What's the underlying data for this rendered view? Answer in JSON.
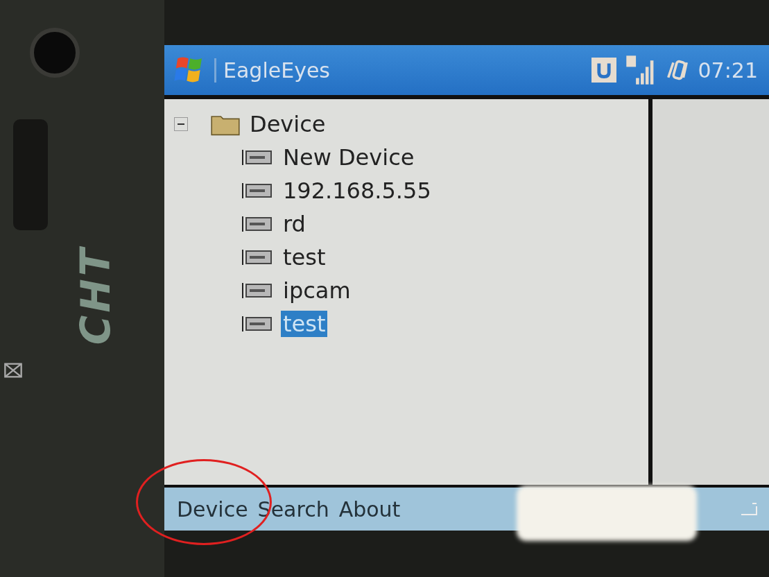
{
  "device_label": "CHT",
  "window": {
    "title": "EagleEyes",
    "time": "07:21"
  },
  "tree": {
    "label": "Device",
    "expanded": true,
    "children": [
      {
        "label": "New Device",
        "selected": false
      },
      {
        "label": "192.168.5.55",
        "selected": false
      },
      {
        "label": "rd",
        "selected": false
      },
      {
        "label": "test",
        "selected": false
      },
      {
        "label": "ipcam",
        "selected": false
      },
      {
        "label": "test",
        "selected": true
      }
    ]
  },
  "menu_bar": {
    "items": [
      "Device",
      "Search",
      "About"
    ]
  }
}
